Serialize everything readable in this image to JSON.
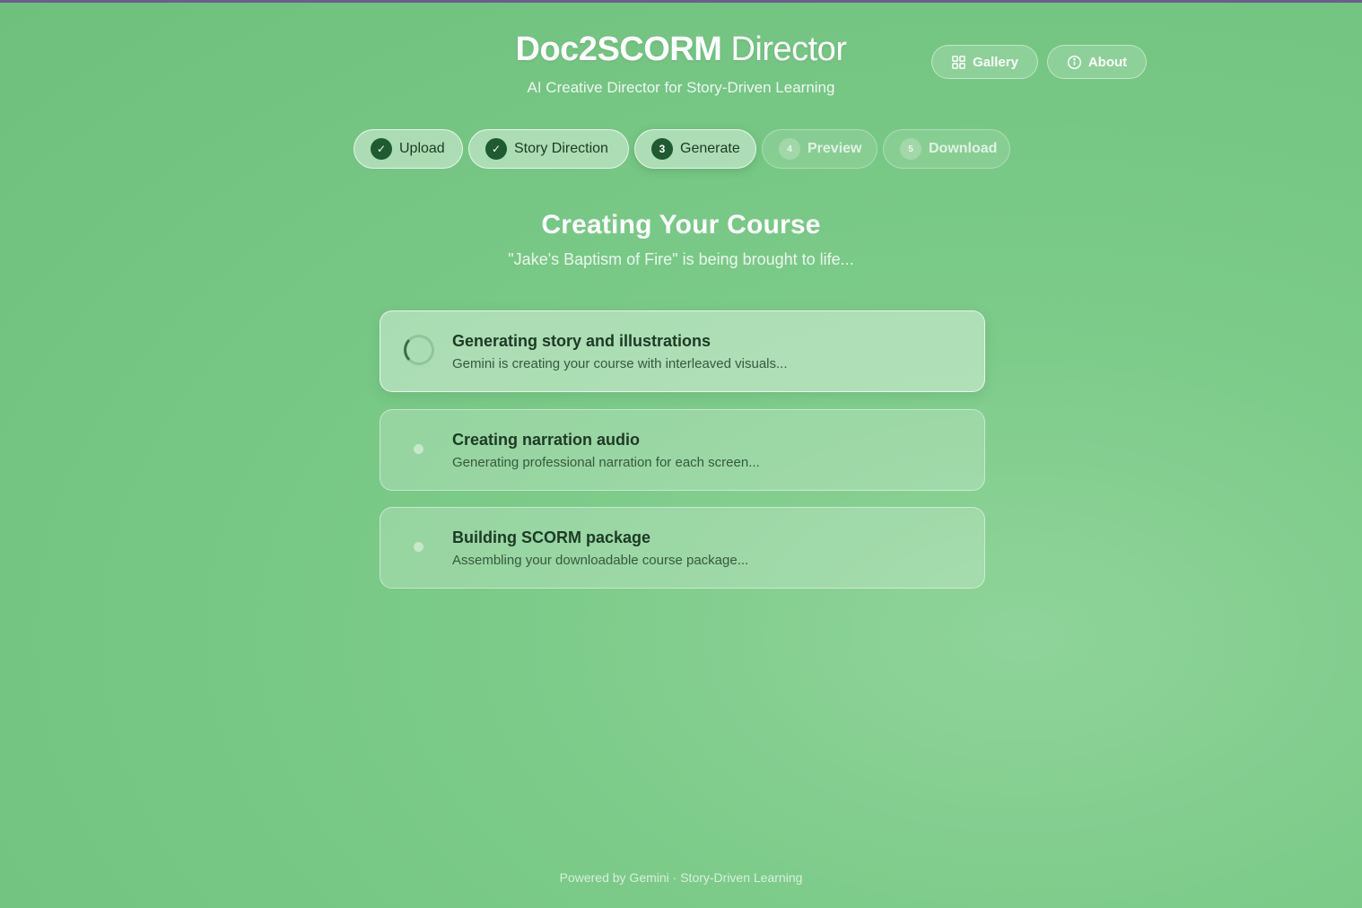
{
  "header": {
    "title_part1": "Doc2SCORM",
    "title_part2": "Director",
    "subtitle": "AI Creative Director for Story-Driven Learning",
    "gallery_label": "Gallery",
    "about_label": "About"
  },
  "steps": [
    {
      "badge": "✓",
      "label": "Upload",
      "state": "done"
    },
    {
      "badge": "✓",
      "label": "Story Direction",
      "state": "done"
    },
    {
      "badge": "3",
      "label": "Generate",
      "state": "active"
    },
    {
      "badge": "4",
      "label": "Preview",
      "state": "pending"
    },
    {
      "badge": "5",
      "label": "Download",
      "state": "pending"
    }
  ],
  "main": {
    "title": "Creating Your Course",
    "subtitle": "\"Jake's Baptism of Fire\" is being brought to life..."
  },
  "tasks": [
    {
      "title": "Generating story and illustrations",
      "description": "Gemini is creating your course with interleaved visuals...",
      "state": "in-progress"
    },
    {
      "title": "Creating narration audio",
      "description": "Generating professional narration for each screen...",
      "state": "pending"
    },
    {
      "title": "Building SCORM package",
      "description": "Assembling your downloadable course package...",
      "state": "pending"
    }
  ],
  "footer": {
    "text": "Powered by Gemini · Story-Driven Learning"
  },
  "colors": {
    "background": "#76c784",
    "accent_dark": "#1f5a30",
    "text_dark": "#1d3a24",
    "top_rule": "#6b5e8e"
  },
  "icons": {
    "gallery": "grid-icon",
    "about": "info-icon",
    "step_done": "check-icon",
    "task_active": "spinner-icon",
    "task_pending": "dot-icon"
  }
}
